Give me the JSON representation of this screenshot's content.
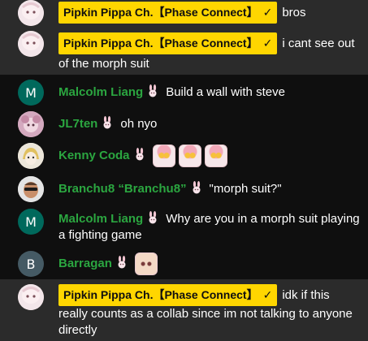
{
  "messages": [
    {
      "author": "Pipkin Pippa Ch.【Phase Connect】",
      "verified_icon": "checkmark-icon",
      "text": "bros",
      "owner": true,
      "avatar_type": "pippa"
    },
    {
      "author": "Pipkin Pippa Ch.【Phase Connect】",
      "verified_icon": "checkmark-icon",
      "text": "i cant see out of the morph suit",
      "owner": true,
      "avatar_type": "pippa"
    },
    {
      "author": "Malcolm Liang",
      "avatar_letter": "M",
      "text": "Build a wall with steve",
      "badge": "member-bunny-badge"
    },
    {
      "author": "JL7ten",
      "text": "oh nyo",
      "badge": "member-bunny-badge"
    },
    {
      "author": "Kenny Coda",
      "text": "",
      "badge": "member-bunny-badge",
      "emotes": [
        "pippa-emote",
        "pippa-emote",
        "pippa-emote"
      ]
    },
    {
      "author": "Branchu8 “Branchu8”",
      "text": "\"morph suit?\"",
      "badge": "member-bunny-badge"
    },
    {
      "author": "Malcolm Liang",
      "avatar_letter": "M",
      "text": "Why are you in a morph suit playing a fighting game",
      "badge": "member-bunny-badge"
    },
    {
      "author": "Barragan",
      "avatar_letter": "B",
      "text": "",
      "badge": "member-bunny-badge",
      "emotes": [
        "pippa-face-emote"
      ]
    },
    {
      "author": "Pipkin Pippa Ch.【Phase Connect】",
      "verified_icon": "checkmark-icon",
      "text": "idk if this really counts as a collab since im not talking to anyone directly",
      "owner": true,
      "avatar_type": "pippa"
    }
  ],
  "colors": {
    "background": "#0f0f0f",
    "highlight_row": "#2b2b2b",
    "owner_chip": "#ffd600",
    "member_name": "#2ba640",
    "avatar_malcolm": "#00695c",
    "avatar_barragan": "#455a64"
  }
}
